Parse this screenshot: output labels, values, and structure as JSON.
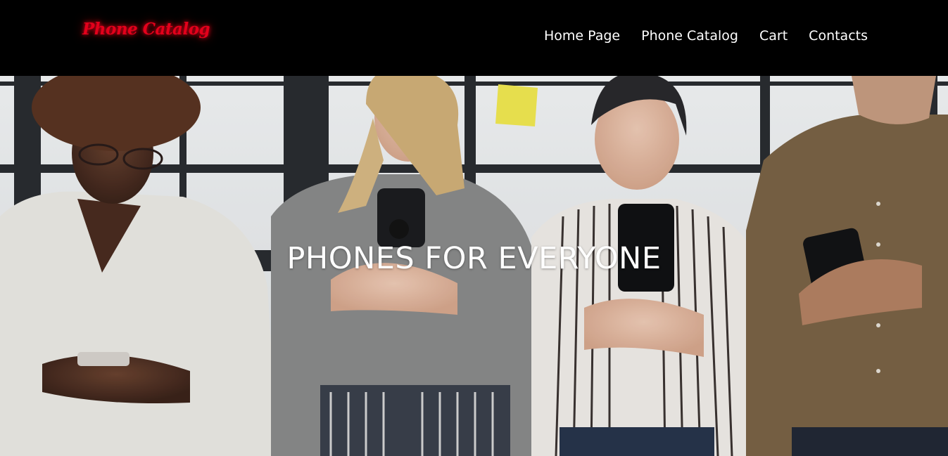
{
  "header": {
    "logo_text": "Phone Catalog",
    "logo_color": "#e3001b",
    "nav": [
      {
        "label": "Home Page"
      },
      {
        "label": "Phone Catalog"
      },
      {
        "label": "Cart"
      },
      {
        "label": "Contacts"
      }
    ]
  },
  "hero": {
    "title": "PHONES FOR EVERYONE",
    "image": "people-using-smartphones-photo"
  }
}
